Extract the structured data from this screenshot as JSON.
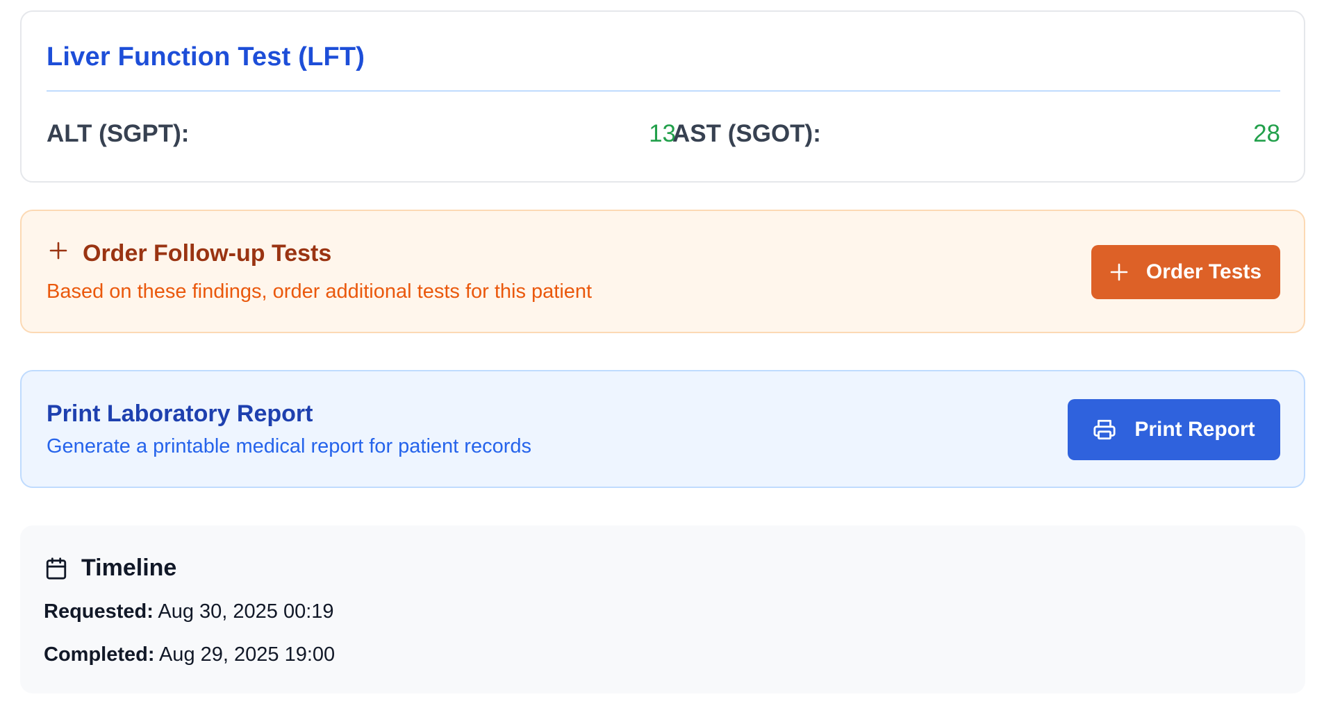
{
  "lft": {
    "title": "Liver Function Test (LFT)",
    "metrics": [
      {
        "label": "ALT (SGPT):",
        "value": "13"
      },
      {
        "label": "AST (SGOT):",
        "value": "28"
      }
    ]
  },
  "followup": {
    "icon": "plus-icon",
    "title": "Order Follow-up Tests",
    "description": "Based on these findings, order additional tests for this patient",
    "button_label": "Order Tests",
    "button_icon": "plus-icon"
  },
  "print": {
    "title": "Print Laboratory Report",
    "description": "Generate a printable medical report for patient records",
    "button_label": "Print Report",
    "button_icon": "printer-icon"
  },
  "timeline": {
    "icon": "calendar-icon",
    "title": "Timeline",
    "requested_label": "Requested:",
    "requested_value": "Aug 30, 2025 00:19",
    "completed_label": "Completed:",
    "completed_value": "Aug 29, 2025 19:00"
  },
  "colors": {
    "lft_title": "#1d4ed8",
    "metric_value": "#22a04b",
    "followup_bg": "#fff6ec",
    "order_button": "#dd6127",
    "print_bg": "#eef5ff",
    "print_button": "#2f62dd",
    "timeline_bg": "#f8f9fb"
  }
}
